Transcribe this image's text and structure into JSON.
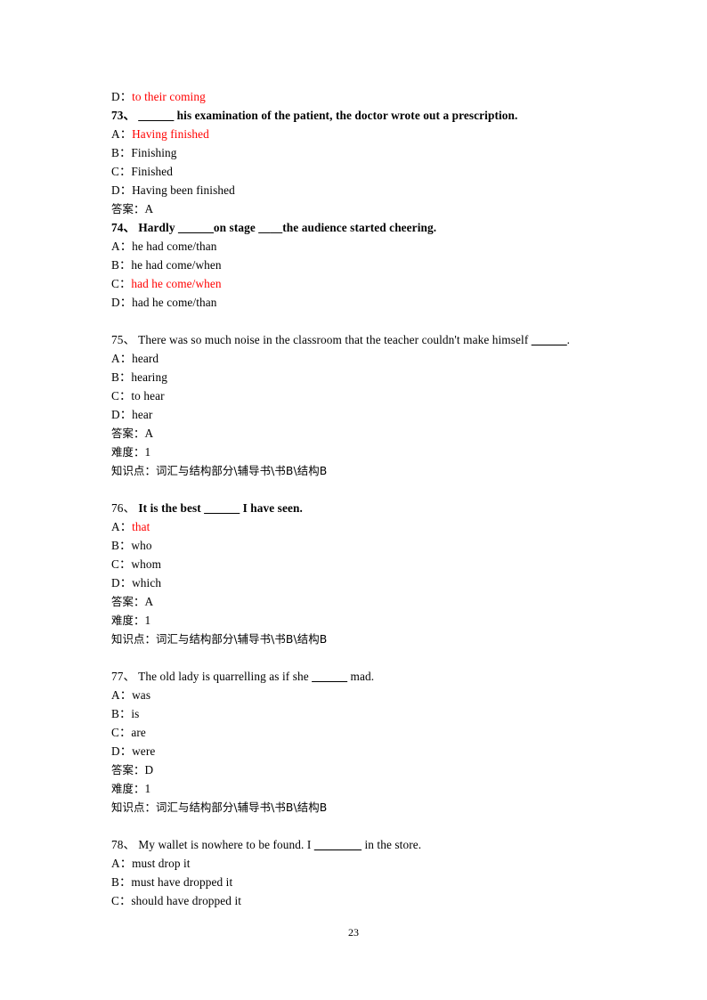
{
  "page": {
    "page_number": "23",
    "accent_red": "#ff0000",
    "text_color": "#000000",
    "background": "#ffffff"
  },
  "carryover_option": {
    "prefix": "D：",
    "text": "to their coming",
    "color": "red"
  },
  "questions": [
    {
      "number": "73、",
      "number_bold": true,
      "stem_bold": true,
      "stem_prefix": "",
      "blank": "______",
      "stem": " his examination of the patient, the doctor wrote out a prescription.",
      "options": [
        {
          "prefix": "A：",
          "text": "Having finished",
          "color": "red"
        },
        {
          "prefix": "B：",
          "text": "Finishing",
          "color": "black"
        },
        {
          "prefix": "C：",
          "text": "Finished",
          "color": "black"
        },
        {
          "prefix": "D：",
          "text": "Having been finished",
          "color": "black"
        }
      ],
      "answer_label": "答案：",
      "answer_value": "A",
      "difficulty_label": "",
      "difficulty_value": "",
      "knowledge_label": "",
      "knowledge_value": ""
    },
    {
      "number": "74、",
      "number_bold": true,
      "stem_bold": true,
      "stem_prefix": "Hardly ",
      "blank": "______",
      "stem": "on stage ____the audience started cheering.",
      "options": [
        {
          "prefix": "A：",
          "text": "he had come/than",
          "color": "black"
        },
        {
          "prefix": "B：",
          "text": "he had come/when",
          "color": "black"
        },
        {
          "prefix": "C：",
          "text": "had he come/when",
          "color": "red"
        },
        {
          "prefix": "D：",
          "text": "had he come/than",
          "color": "black"
        }
      ],
      "answer_label": "",
      "answer_value": "",
      "difficulty_label": "",
      "difficulty_value": "",
      "knowledge_label": "",
      "knowledge_value": ""
    },
    {
      "number": "75、",
      "number_bold": false,
      "stem_bold": false,
      "stem_prefix": "There was so much noise in the classroom that the teacher couldn't make himself ",
      "blank": "______",
      "stem": ".",
      "options": [
        {
          "prefix": "A：",
          "text": "heard",
          "color": "black"
        },
        {
          "prefix": "B：",
          "text": "hearing",
          "color": "black"
        },
        {
          "prefix": "C：",
          "text": "to hear",
          "color": "black"
        },
        {
          "prefix": "D：",
          "text": "hear",
          "color": "black"
        }
      ],
      "answer_label": "答案：",
      "answer_value": "A",
      "difficulty_label": "难度：",
      "difficulty_value": "1",
      "knowledge_label": "知识点：",
      "knowledge_value": "词汇与结构部分\\辅导书\\书B\\结构B"
    },
    {
      "number": "76、",
      "number_bold": false,
      "stem_bold": true,
      "stem_prefix": "It is the best ",
      "blank": "______",
      "stem": " I have seen.",
      "options": [
        {
          "prefix": "A：",
          "text": "that",
          "color": "red"
        },
        {
          "prefix": "B：",
          "text": "who",
          "color": "black"
        },
        {
          "prefix": "C：",
          "text": "whom",
          "color": "black"
        },
        {
          "prefix": "D：",
          "text": "which",
          "color": "black"
        }
      ],
      "answer_label": "答案：",
      "answer_value": "A",
      "difficulty_label": "难度：",
      "difficulty_value": "1",
      "knowledge_label": "知识点：",
      "knowledge_value": "词汇与结构部分\\辅导书\\书B\\结构B"
    },
    {
      "number": "77、",
      "number_bold": false,
      "stem_bold": false,
      "stem_prefix": "The old lady is quarrelling as if she ",
      "blank": "______",
      "stem": " mad.",
      "options": [
        {
          "prefix": "A：",
          "text": "was",
          "color": "black"
        },
        {
          "prefix": "B：",
          "text": "is",
          "color": "black"
        },
        {
          "prefix": "C：",
          "text": "are",
          "color": "black"
        },
        {
          "prefix": "D：",
          "text": "were",
          "color": "black"
        }
      ],
      "answer_label": "答案：",
      "answer_value": "D",
      "difficulty_label": "难度：",
      "difficulty_value": "1",
      "knowledge_label": "知识点：",
      "knowledge_value": "词汇与结构部分\\辅导书\\书B\\结构B"
    },
    {
      "number": "78、",
      "number_bold": false,
      "stem_bold": false,
      "stem_prefix": "My wallet is nowhere to be found. I ",
      "blank": "________",
      "stem": " in the store.",
      "options": [
        {
          "prefix": "A：",
          "text": "must drop it",
          "color": "black"
        },
        {
          "prefix": "B：",
          "text": "must have dropped it",
          "color": "black"
        },
        {
          "prefix": "C：",
          "text": "should have dropped it",
          "color": "black"
        }
      ],
      "answer_label": "",
      "answer_value": "",
      "difficulty_label": "",
      "difficulty_value": "",
      "knowledge_label": "",
      "knowledge_value": ""
    }
  ]
}
